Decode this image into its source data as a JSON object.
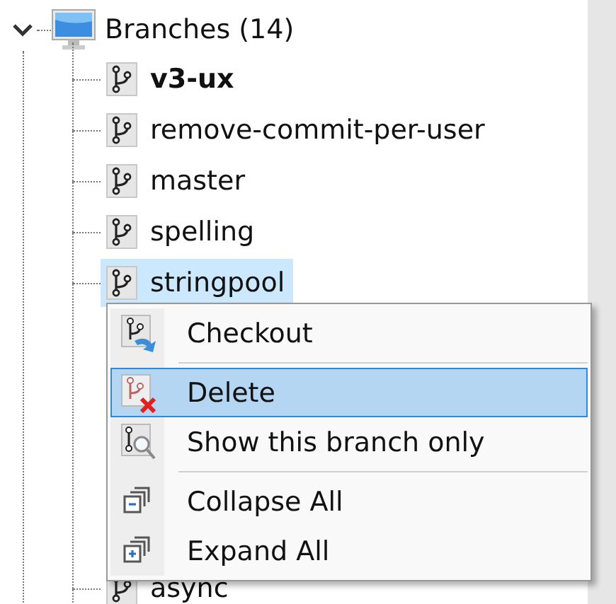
{
  "tree": {
    "label": "Branches (14)",
    "expanded": true,
    "children": [
      {
        "label": "v3-ux",
        "current": true,
        "selected": false
      },
      {
        "label": "remove-commit-per-user",
        "current": false,
        "selected": false
      },
      {
        "label": "master",
        "current": false,
        "selected": false
      },
      {
        "label": "spelling",
        "current": false,
        "selected": false
      },
      {
        "label": "stringpool",
        "current": false,
        "selected": true
      },
      {
        "label": "async",
        "current": false,
        "selected": false
      }
    ]
  },
  "context_menu": {
    "items": [
      {
        "kind": "item",
        "label": "Checkout",
        "selected": false
      },
      {
        "kind": "separator"
      },
      {
        "kind": "item",
        "label": "Delete",
        "selected": true
      },
      {
        "kind": "item",
        "label": "Show this branch only",
        "selected": false
      },
      {
        "kind": "separator"
      },
      {
        "kind": "item",
        "label": "Collapse All",
        "selected": false
      },
      {
        "kind": "item",
        "label": "Expand All",
        "selected": false
      }
    ]
  }
}
